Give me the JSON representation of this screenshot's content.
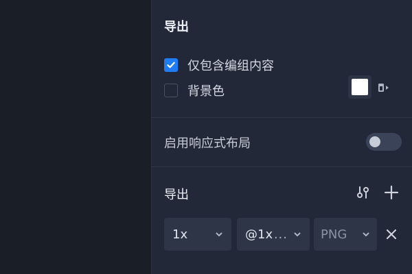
{
  "canvas": {},
  "panel": {
    "export_title": "导出",
    "only_group_content": {
      "label": "仅包含编组内容",
      "checked": true
    },
    "background": {
      "label": "背景色",
      "checked": false,
      "color": "#ffffff"
    },
    "responsive": {
      "label": "启用响应式布局",
      "enabled": false
    },
    "export_list": {
      "title": "导出",
      "rows": [
        {
          "scale": "1x",
          "suffix": "@1x",
          "suffix_more": "...",
          "format": "PNG"
        }
      ]
    }
  },
  "colors": {
    "accent": "#1f7cf3",
    "panel_bg": "#222838",
    "canvas_bg": "#1a1e27"
  },
  "icons": {
    "check": "check-icon",
    "fill": "fill-bucket-icon",
    "adjust": "adjust-icon",
    "add": "plus-icon",
    "remove": "close-icon",
    "chevron": "chevron-down-icon"
  }
}
